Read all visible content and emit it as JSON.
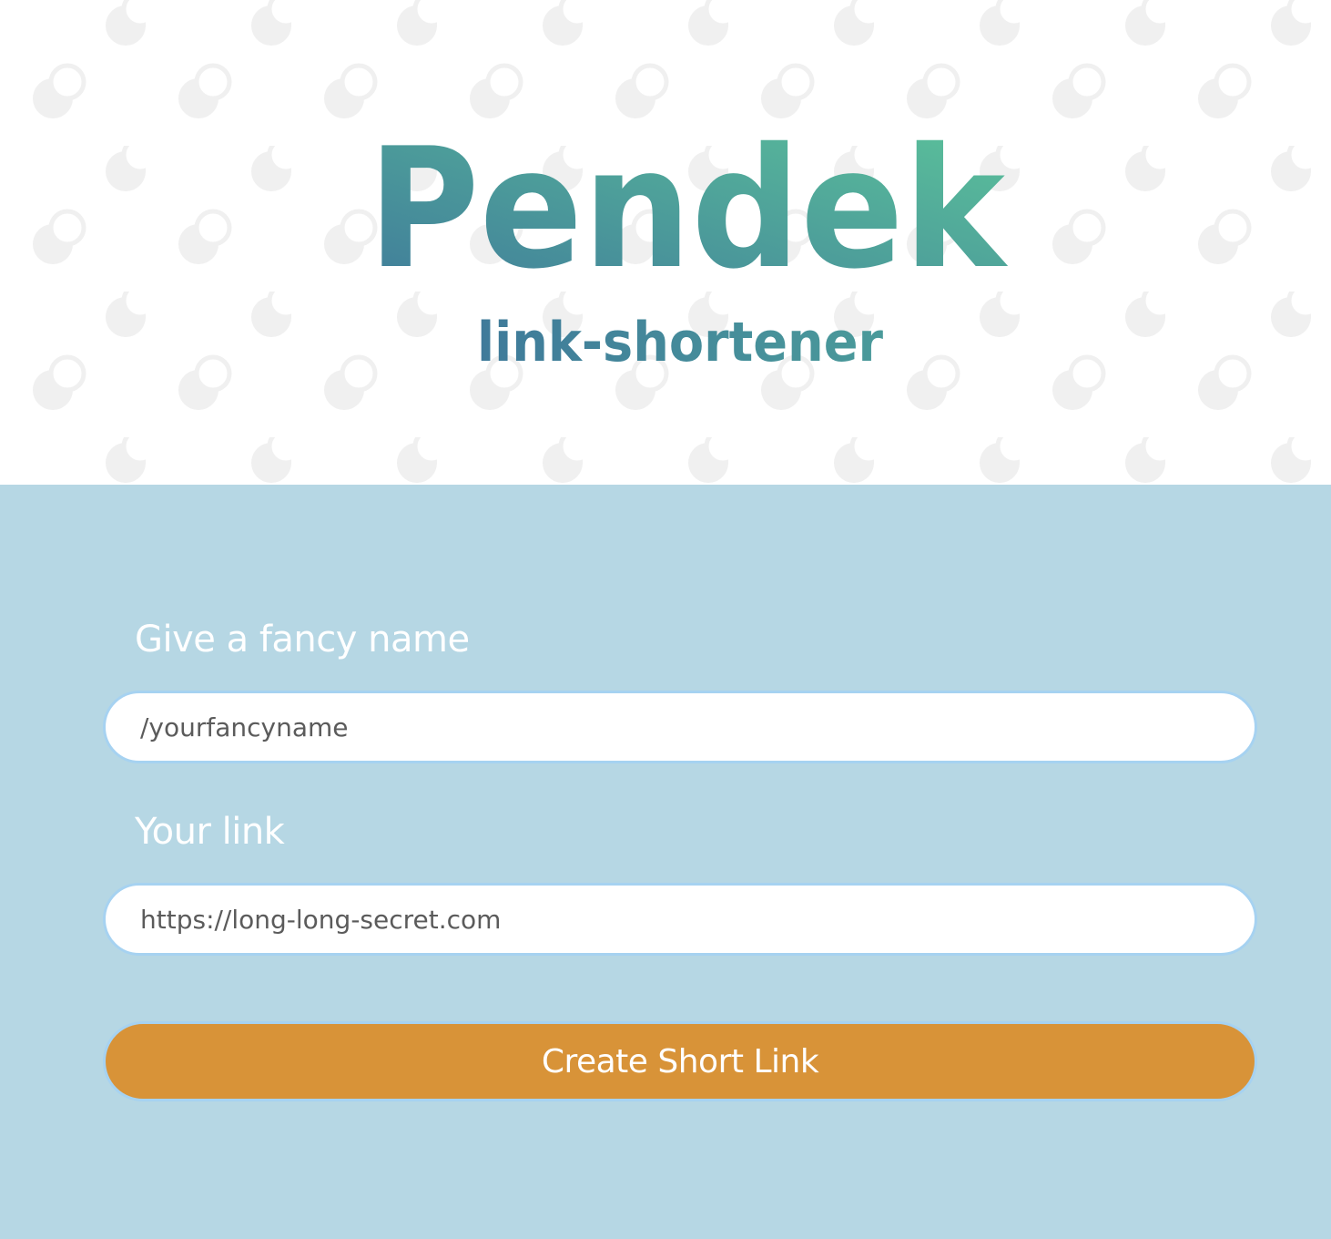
{
  "brand": {
    "title": "Pendek",
    "subtitle": "link-shortener",
    "gradient_start": "#3f7a9a",
    "gradient_end": "#5cc49a"
  },
  "header": {
    "background": "#ffffff",
    "pattern_color": "#f1f1f1",
    "pattern_icon": "toggle-circle-icon"
  },
  "form": {
    "background": "#b6d7e4",
    "fancy_name": {
      "label": "Give a fancy name",
      "placeholder": "/yourfancyname",
      "value": ""
    },
    "link": {
      "label": "Your link",
      "placeholder": "https://long-long-secret.com",
      "value": ""
    },
    "submit_label": "Create Short Link",
    "submit_color": "#d89338",
    "input_border_color": "#a6d2f1"
  }
}
